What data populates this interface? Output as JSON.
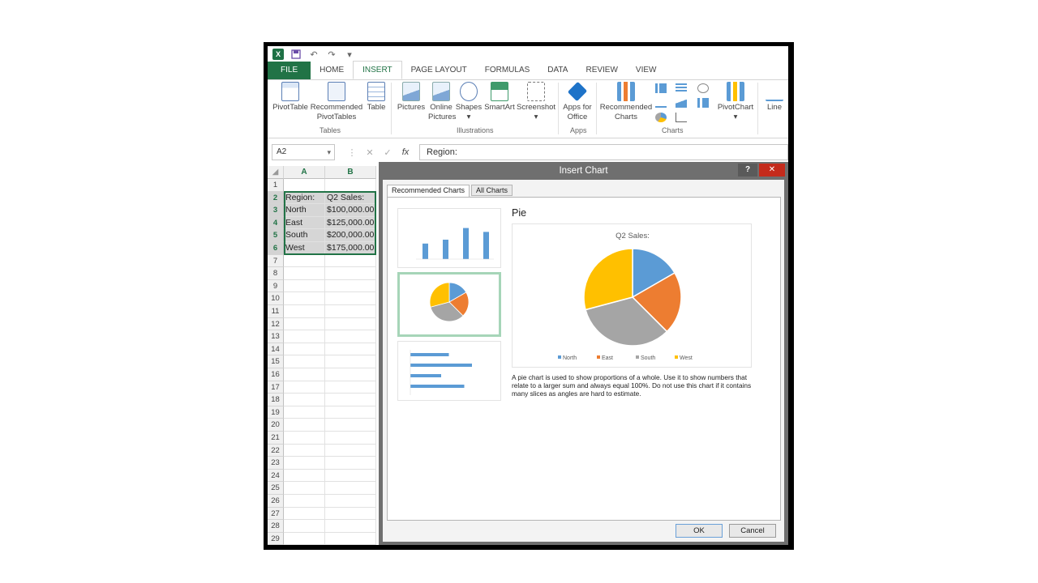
{
  "qat": {
    "undo": "↶",
    "redo": "↷"
  },
  "tabs": [
    "FILE",
    "HOME",
    "INSERT",
    "PAGE LAYOUT",
    "FORMULAS",
    "DATA",
    "REVIEW",
    "VIEW"
  ],
  "ribbon": {
    "pivottable": "PivotTable",
    "recommended_pivot_1": "Recommended",
    "recommended_pivot_2": "PivotTables",
    "table": "Table",
    "tables_group": "Tables",
    "pictures": "Pictures",
    "online_1": "Online",
    "online_2": "Pictures",
    "shapes": "Shapes",
    "smartart": "SmartArt",
    "screenshot": "Screenshot",
    "illustrations_group": "Illustrations",
    "apps_1": "Apps for",
    "apps_2": "Office",
    "apps_group": "Apps",
    "rec_charts_1": "Recommended",
    "rec_charts_2": "Charts",
    "charts_group": "Charts",
    "pivotchart": "PivotChart",
    "line": "Line"
  },
  "formula_bar": {
    "name_box": "A2",
    "formula": "Region:",
    "fx": "fx",
    "cancel": "✕",
    "enter": "✓"
  },
  "columns": [
    "A",
    "B"
  ],
  "rows": [
    "1",
    "2",
    "3",
    "4",
    "5",
    "6",
    "7",
    "8",
    "9",
    "10",
    "11",
    "12",
    "13",
    "14",
    "15",
    "16",
    "17",
    "18",
    "19",
    "20",
    "21",
    "22",
    "23",
    "24",
    "25",
    "26",
    "27",
    "28",
    "29"
  ],
  "cells": {
    "a2": "Region:",
    "b2": "Q2 Sales:",
    "a3": "North",
    "b3": "$100,000.00",
    "a4": "East",
    "b4": "$125,000.00",
    "a5": "South",
    "b5": "$200,000.00",
    "a6": "West",
    "b6": "$175,000.00"
  },
  "dialog": {
    "title": "Insert Chart",
    "help": "?",
    "close": "✕",
    "tab_recommended": "Recommended Charts",
    "tab_all": "All Charts",
    "preview_title": "Pie",
    "description": "A pie chart is used to show proportions of a whole. Use it to show numbers that relate to a larger sum and always equal 100%. Do not use this chart if it contains many slices as angles are hard to estimate.",
    "ok": "OK",
    "cancel": "Cancel"
  },
  "chart_data": {
    "type": "pie",
    "title": "Q2 Sales:",
    "categories": [
      "North",
      "East",
      "South",
      "West"
    ],
    "values": [
      100000,
      125000,
      200000,
      175000
    ],
    "colors": [
      "#5b9bd5",
      "#ed7d31",
      "#a5a5a5",
      "#ffc000"
    ],
    "legend": "bottom"
  }
}
